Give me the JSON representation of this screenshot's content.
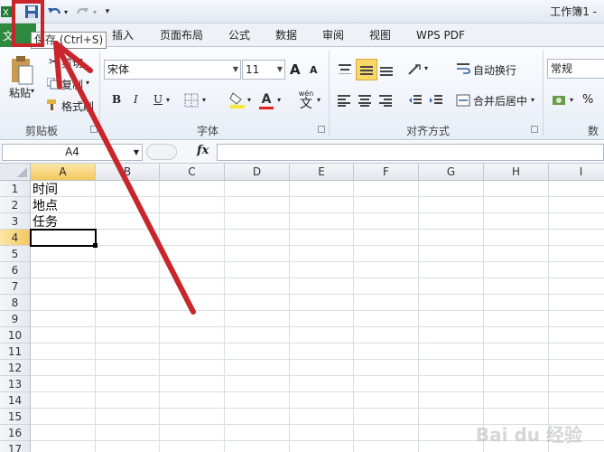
{
  "window": {
    "title": "工作簿1 -"
  },
  "quick_access": {
    "save_icon": "save-icon",
    "undo_icon": "undo-icon",
    "redo_icon": "redo-icon"
  },
  "tooltip": {
    "text": "保存 (Ctrl+S)"
  },
  "tabs": [
    {
      "label": "插入"
    },
    {
      "label": "页面布局"
    },
    {
      "label": "公式"
    },
    {
      "label": "数据"
    },
    {
      "label": "审阅"
    },
    {
      "label": "视图"
    },
    {
      "label": "WPS PDF"
    }
  ],
  "file_tab": {
    "label": "文"
  },
  "clipboard": {
    "paste_label": "粘贴",
    "cut_label": "剪切",
    "copy_label": "复制",
    "format_painter_label": "格式刷",
    "group_label": "剪贴板"
  },
  "font": {
    "name": "宋体",
    "size": "11",
    "grow_label": "A",
    "shrink_label": "A",
    "bold": "B",
    "italic": "I",
    "underline": "U",
    "color_label": "A",
    "group_label": "字体",
    "wen_label": "wén",
    "wen_char": "文"
  },
  "alignment": {
    "wrap_label": "自动换行",
    "merge_label": "合并后居中",
    "group_label": "对齐方式"
  },
  "number": {
    "format": "常规",
    "percent": "%",
    "group_label": "数字"
  },
  "formula_bar": {
    "name_box": "A4",
    "fx": "fx",
    "value": ""
  },
  "columns": [
    "A",
    "B",
    "C",
    "D",
    "E",
    "F",
    "G",
    "H",
    "I"
  ],
  "rows": [
    "1",
    "2",
    "3",
    "4",
    "5",
    "6",
    "7",
    "8",
    "9",
    "10",
    "11",
    "12",
    "13",
    "14",
    "15",
    "16",
    "17"
  ],
  "cells": {
    "A1": "时间",
    "A2": "地点",
    "A3": "任务"
  },
  "watermark": "Bai du 经验",
  "colors": {
    "annotation_red": "#c9262c",
    "file_tab_green": "#2d8a3e",
    "active_header": "#f4c75d"
  }
}
